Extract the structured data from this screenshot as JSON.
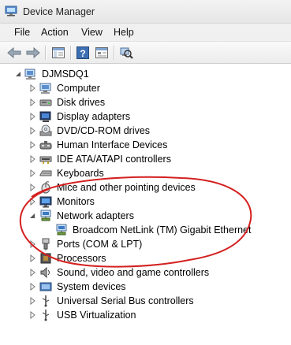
{
  "window": {
    "title": "Device Manager"
  },
  "menu": [
    {
      "name": "menu-file",
      "label": "File"
    },
    {
      "name": "menu-action",
      "label": "Action"
    },
    {
      "name": "menu-view",
      "label": "View"
    },
    {
      "name": "menu-help",
      "label": "Help"
    }
  ],
  "toolbar": [
    "back-icon",
    "forward-icon",
    "show-hide-tree-icon",
    "help-icon",
    "properties-icon",
    "scan-hardware-icon"
  ],
  "tree": {
    "root": "DJMSDQ1",
    "categories": [
      {
        "label": "Computer",
        "icon": "computer-icon",
        "expanded": false
      },
      {
        "label": "Disk drives",
        "icon": "disk-drive-icon",
        "expanded": false
      },
      {
        "label": "Display adapters",
        "icon": "display-adapter-icon",
        "expanded": false
      },
      {
        "label": "DVD/CD-ROM drives",
        "icon": "dvd-drive-icon",
        "expanded": false
      },
      {
        "label": "Human Interface Devices",
        "icon": "hid-icon",
        "expanded": false
      },
      {
        "label": "IDE ATA/ATAPI controllers",
        "icon": "ide-controller-icon",
        "expanded": false
      },
      {
        "label": "Keyboards",
        "icon": "keyboard-icon",
        "expanded": false
      },
      {
        "label": "Mice and other pointing devices",
        "icon": "mouse-icon",
        "expanded": false
      },
      {
        "label": "Monitors",
        "icon": "monitor-icon",
        "expanded": false
      },
      {
        "label": "Network adapters",
        "icon": "network-adapter-icon",
        "expanded": true
      },
      {
        "label": "Broadcom NetLink (TM) Gigabit Ethernet",
        "icon": "network-card-icon",
        "child": true
      },
      {
        "label": "Ports (COM & LPT)",
        "icon": "port-icon",
        "expanded": false
      },
      {
        "label": "Processors",
        "icon": "processor-icon",
        "expanded": false
      },
      {
        "label": "Sound, video and game controllers",
        "icon": "sound-icon",
        "expanded": false
      },
      {
        "label": "System devices",
        "icon": "system-device-icon",
        "expanded": false
      },
      {
        "label": "Universal Serial Bus controllers",
        "icon": "usb-icon",
        "expanded": false
      },
      {
        "label": "USB Virtualization",
        "icon": "usb-virtualization-icon",
        "expanded": false
      }
    ]
  },
  "colors": {
    "annotation": "#d42020",
    "accent": "#2a6cc4"
  }
}
